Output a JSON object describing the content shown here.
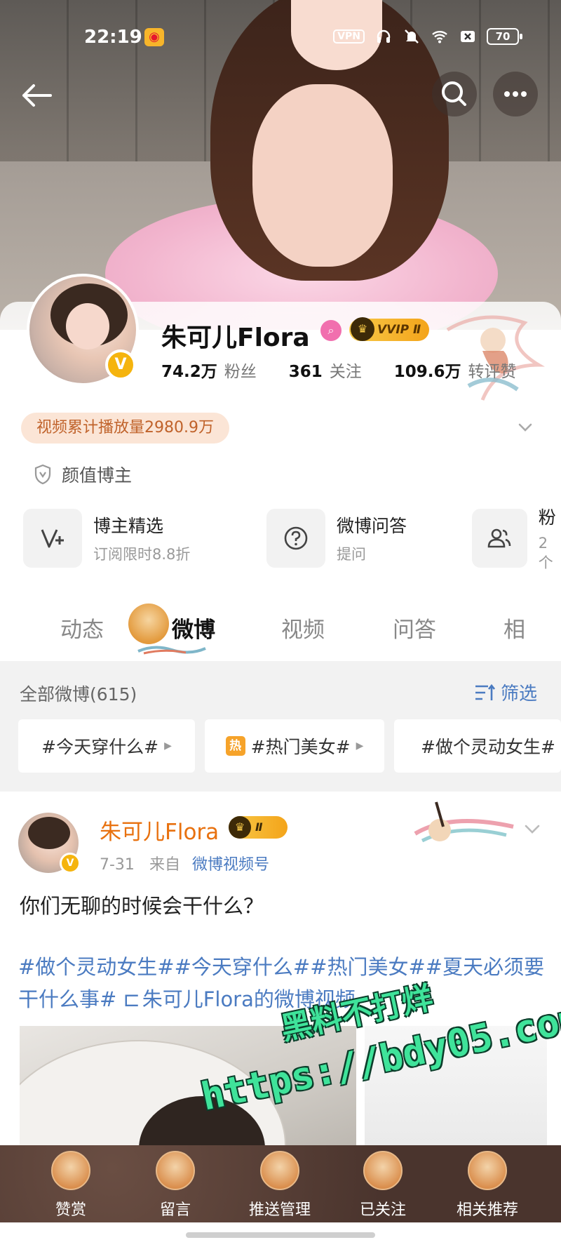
{
  "status_bar": {
    "time": "22:19",
    "vpn": "VPN",
    "battery": "70"
  },
  "profile": {
    "name": "朱可儿Flora",
    "vvip_label": "VVIP Ⅱ",
    "verify_mark": "V",
    "stats": [
      {
        "value": "74.2万",
        "label": "粉丝"
      },
      {
        "value": "361",
        "label": "关注"
      },
      {
        "value": "109.6万",
        "label": "转评赞"
      }
    ],
    "play_count": "视频累计播放量2980.9万",
    "tag": "颜值博主"
  },
  "tiles": [
    {
      "title": "博主精选",
      "sub": "订阅限时8.8折",
      "icon": "v-plus-icon"
    },
    {
      "title": "微博问答",
      "sub": "提问",
      "icon": "question-icon"
    },
    {
      "title": "粉",
      "sub": "2个",
      "icon": "fans-group-icon"
    }
  ],
  "tabs": [
    {
      "label": "动态"
    },
    {
      "label": "微博"
    },
    {
      "label": "视频"
    },
    {
      "label": "问答"
    },
    {
      "label": "相"
    }
  ],
  "filter": {
    "all_label": "全部微博(615)",
    "filter_label": "筛选",
    "chips": [
      {
        "label": "#今天穿什么#"
      },
      {
        "label": "#热门美女#",
        "hot": "热"
      },
      {
        "label": "#做个灵动女生#"
      }
    ]
  },
  "post": {
    "author": "朱可儿Flora",
    "crown_label": "Ⅱ",
    "date": "7-31",
    "from": "来自",
    "source": "微博视频号",
    "text": "你们无聊的时候会干什么？",
    "tags": "#做个灵动女生##今天穿什么##热门美女##夏天必须要干什么事# ⊏ 朱可儿Flora的微博视频"
  },
  "watermark": {
    "line1": "黑料不打烊",
    "line2": "https://bdy05.com"
  },
  "bottom_bar": [
    {
      "label": "赞赏"
    },
    {
      "label": "留言"
    },
    {
      "label": "推送管理"
    },
    {
      "label": "已关注"
    },
    {
      "label": "相关推荐"
    }
  ],
  "colors": {
    "link": "#4b7bc1",
    "author": "#e8710f",
    "gold": "#f5b40e",
    "play_bg": "#fbe5d6",
    "play_text": "#c0622a"
  }
}
